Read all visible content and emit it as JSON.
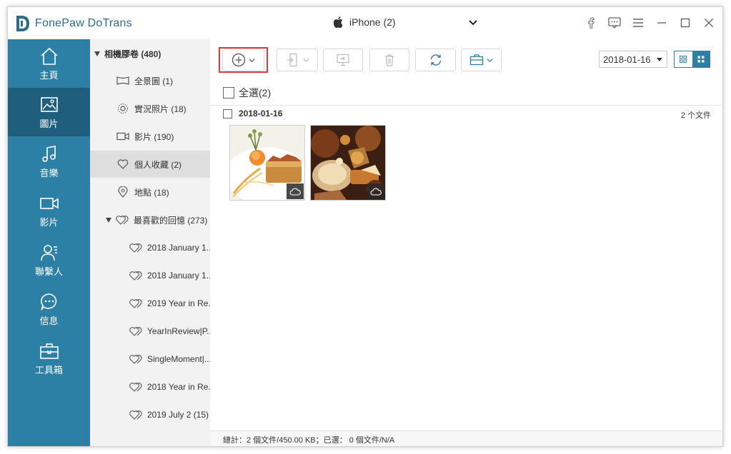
{
  "app": {
    "title": "FonePaw DoTrans",
    "device": "iPhone (2)",
    "accent": "#2c7fa5",
    "nav_active_color": "#1f5e7d"
  },
  "nav": {
    "items": [
      {
        "label": "主頁",
        "icon": "home-icon"
      },
      {
        "label": "圖片",
        "icon": "photo-icon",
        "active": true
      },
      {
        "label": "音樂",
        "icon": "music-icon"
      },
      {
        "label": "影片",
        "icon": "video-icon"
      },
      {
        "label": "聯繫人",
        "icon": "contacts-icon"
      },
      {
        "label": "信息",
        "icon": "message-icon"
      },
      {
        "label": "工具箱",
        "icon": "toolbox-icon"
      }
    ]
  },
  "tree": {
    "root": "相機膠卷 (480)",
    "items": [
      "全景圖 (1)",
      "實況照片 (18)",
      "影片 (190)",
      "個人收藏 (2)",
      "地點 (18)"
    ],
    "memories": "最喜歡的回憶 (273)",
    "memory_items": [
      "2018 January 1...",
      "2018 January 1...",
      "2019 Year in Re...",
      "YearInReview|P...",
      "SingleMoment|...",
      "2018 Year in Re...",
      "2019 July 2 (15)"
    ]
  },
  "toolbar": {
    "date_value": "2018-01-16"
  },
  "content": {
    "select_all": "全選(2)",
    "group_date": "2018-01-16",
    "group_count": "2 个文件"
  },
  "status": {
    "text": "總計：2 個文件/450.00 KB；已選： 0 個文件/N/A"
  }
}
